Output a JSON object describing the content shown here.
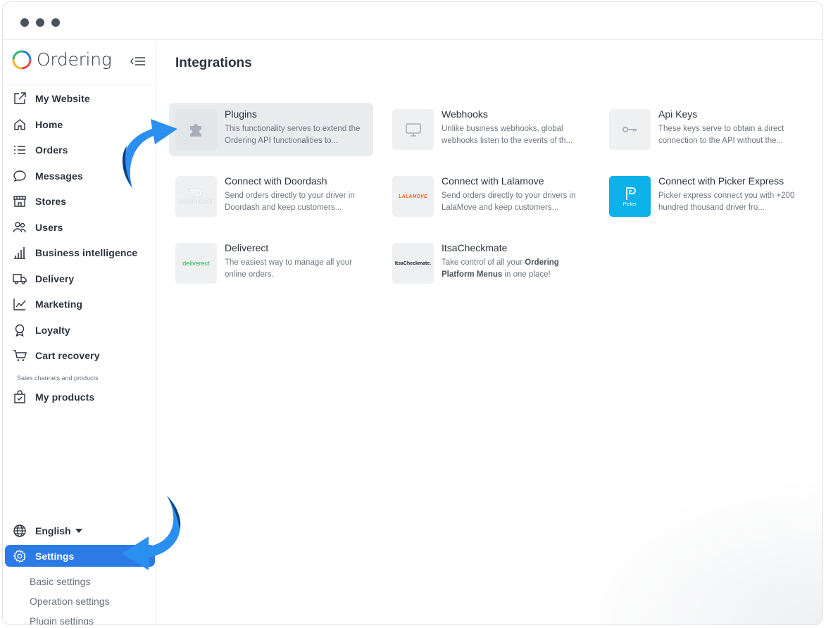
{
  "brand": {
    "name": "Ordering"
  },
  "nav": {
    "items": [
      {
        "label": "My Website",
        "icon": "external-link-icon"
      },
      {
        "label": "Home",
        "icon": "home-icon"
      },
      {
        "label": "Orders",
        "icon": "list-icon"
      },
      {
        "label": "Messages",
        "icon": "chat-bubble-icon"
      },
      {
        "label": "Stores",
        "icon": "storefront-icon"
      },
      {
        "label": "Users",
        "icon": "users-icon"
      },
      {
        "label": "Business intelligence",
        "icon": "bar-chart-icon"
      },
      {
        "label": "Delivery",
        "icon": "truck-icon"
      },
      {
        "label": "Marketing",
        "icon": "trend-line-icon"
      },
      {
        "label": "Loyalty",
        "icon": "award-icon"
      },
      {
        "label": "Cart recovery",
        "icon": "cart-icon"
      }
    ],
    "section_label": "Sales channels and products",
    "products_label": "My products",
    "language": "English",
    "settings_label": "Settings",
    "settings_sub": [
      "Basic settings",
      "Operation settings",
      "Plugin settings"
    ]
  },
  "main": {
    "title": "Integrations",
    "cards": [
      {
        "title": "Plugins",
        "desc": "This functionality serves to extend the Ordering API functionalities to..."
      },
      {
        "title": "Webhooks",
        "desc": "Unlike business webhooks, global webhooks listen to the events of th..."
      },
      {
        "title": "Api Keys",
        "desc": "These keys serve to obtain a direct connection to the API without the..."
      },
      {
        "title": "Connect with Doordash",
        "desc": "Send orders directly to your driver in Doordash and keep customers...",
        "logo": "DOORDASH"
      },
      {
        "title": "Connect with Lalamove",
        "desc": "Send orders directly to your drivers in LalaMove and keep customers...",
        "logo": "LALAMOVE"
      },
      {
        "title": "Connect with Picker Express",
        "desc": "Picker express connect you with +200 hundred thousand driver fro...",
        "logo": "Picker"
      },
      {
        "title": "Deliverect",
        "desc": "The easiest way to manage all your online orders.",
        "logo": "deliverect"
      },
      {
        "title": "ItsaCheckmate",
        "desc_pre": "Take control of all your ",
        "desc_bold": "Ordering Platform Menus",
        "desc_post": " in one place!",
        "logo": "ItsaCheckmate."
      }
    ]
  },
  "colors": {
    "accent": "#2c7be5",
    "arrow": "#2b8ff0",
    "picker": "#0bb1e8",
    "deliverect": "#25b34a",
    "lalamove": "#f16622"
  }
}
